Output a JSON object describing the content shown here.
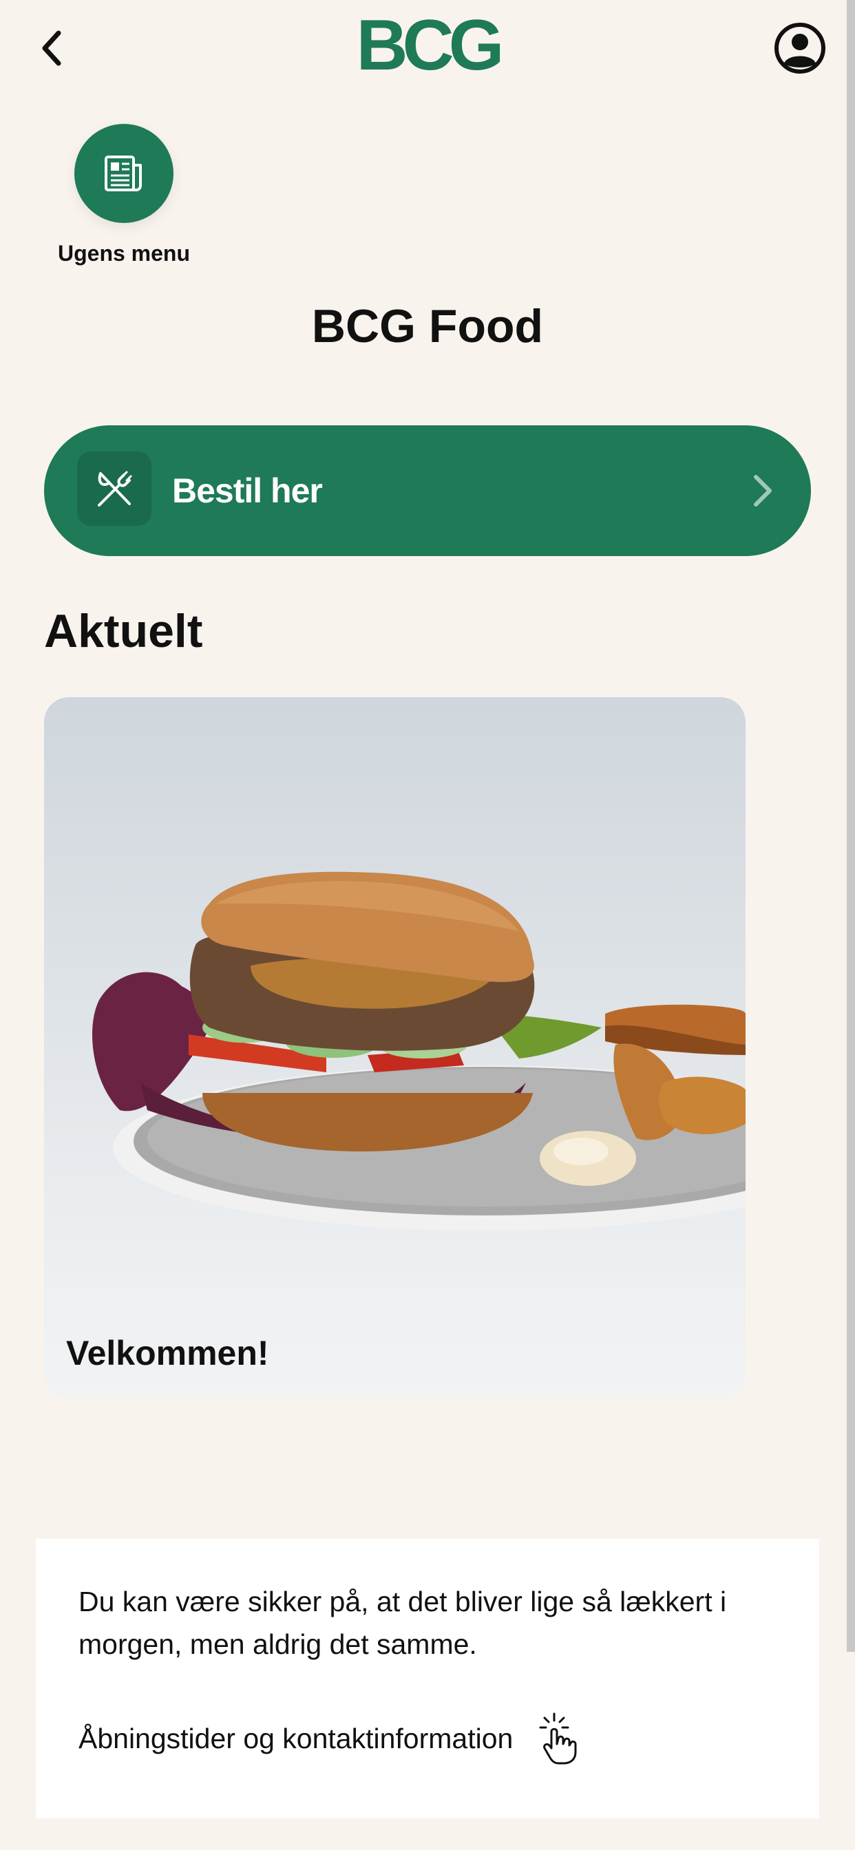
{
  "header": {
    "logo_text": "BCG",
    "back_icon": "chevron-left-icon",
    "profile_icon": "user-circle-icon"
  },
  "quick_actions": [
    {
      "label": "Ugens menu",
      "icon": "newspaper-icon"
    }
  ],
  "page_title": "BCG Food",
  "order_button": {
    "label": "Bestil her",
    "icon": "fork-knife-icon",
    "chevron": "chevron-right-icon"
  },
  "section": {
    "heading": "Aktuelt"
  },
  "news": [
    {
      "title": "Velkommen!"
    }
  ],
  "info": {
    "text": "Du kan være sikker på, at det bliver lige så lækkert i morgen, men aldrig det samme.",
    "link_label": "Åbningstider og kontaktinformation",
    "link_icon": "tap-hand-icon"
  },
  "colors": {
    "background": "#f9f3ee",
    "brand_green": "#1e7a57",
    "panel": "#ffffff"
  }
}
